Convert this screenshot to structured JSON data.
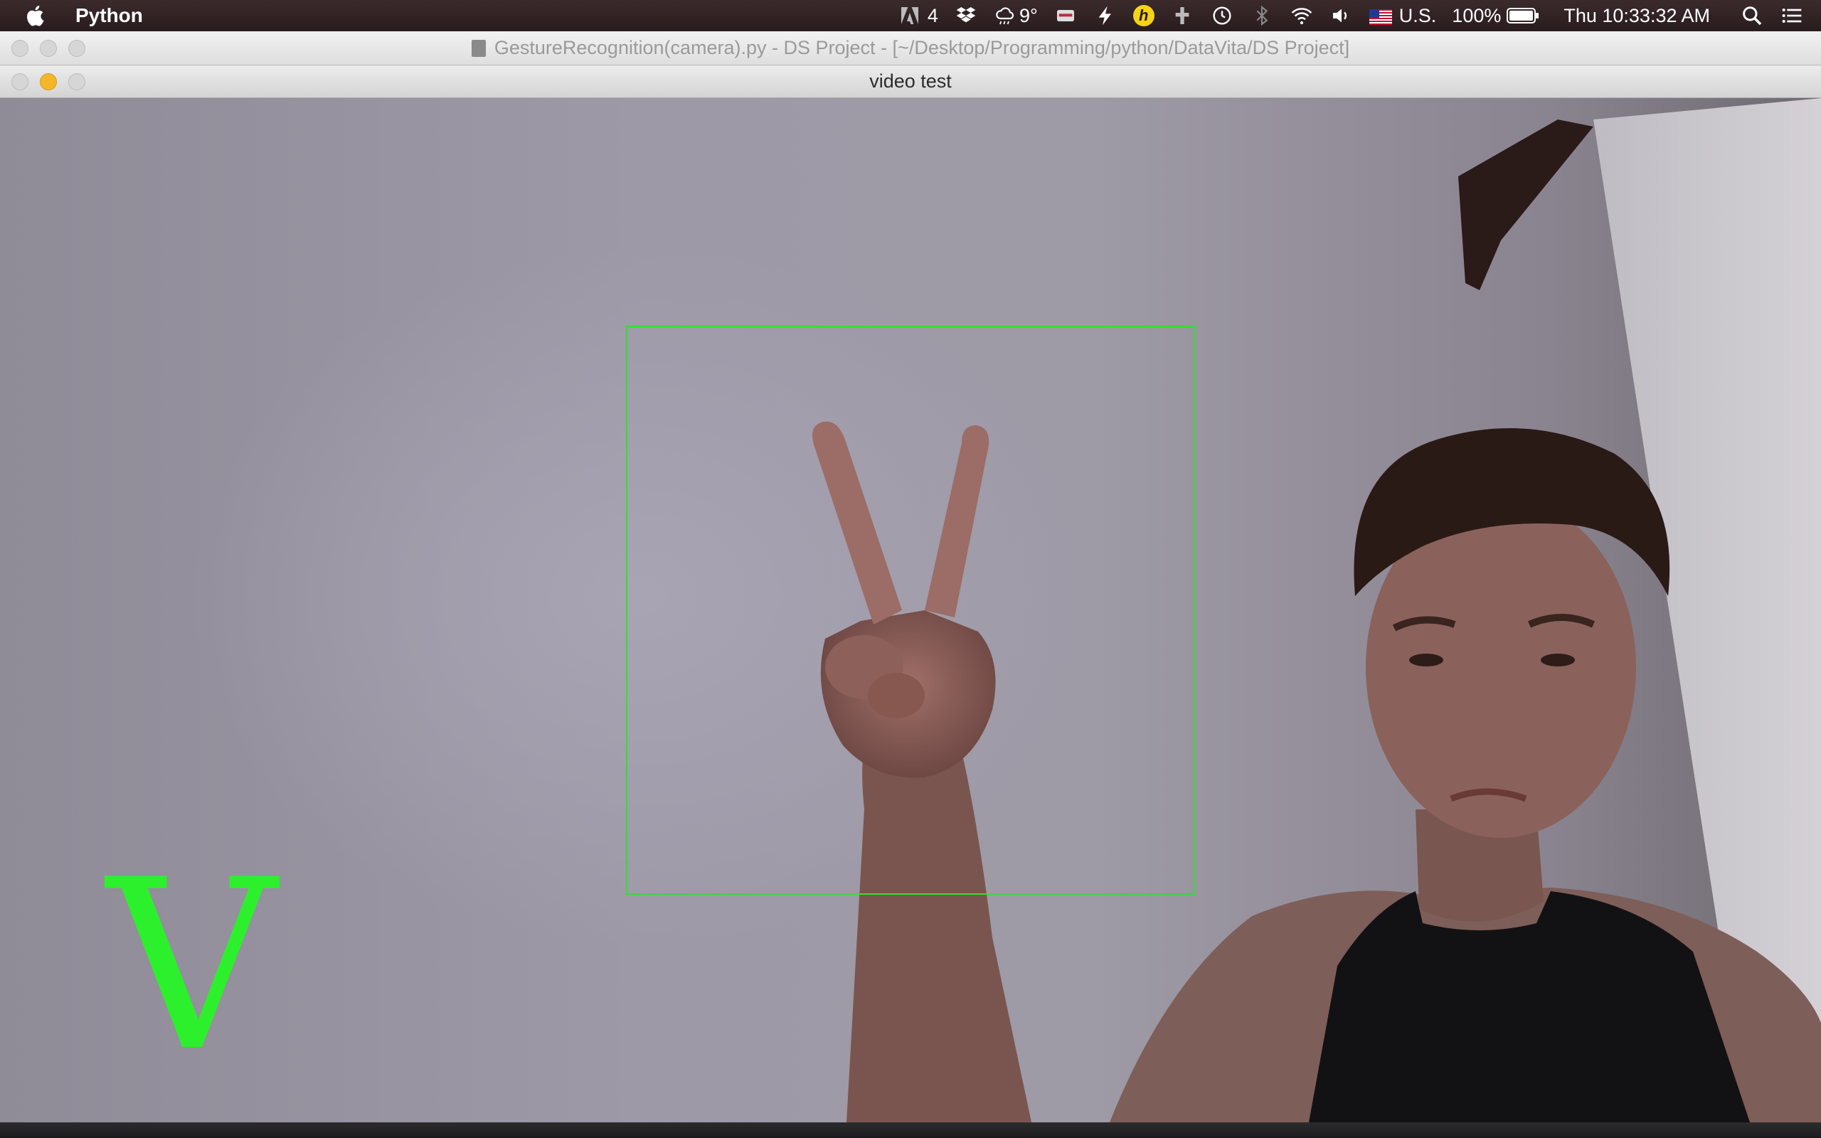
{
  "menubar": {
    "app_name": "Python",
    "adobe_count": "4",
    "weather_temp": "9°",
    "input_source": "U.S.",
    "battery_percent": "100%",
    "clock": "Thu 10:33:32 AM",
    "icons": [
      "apple-icon",
      "adobe-icon",
      "dropbox-icon",
      "weather-icon",
      "vpn-icon",
      "flash-icon",
      "h-badge-icon",
      "usb-icon",
      "time-machine-icon",
      "bluetooth-icon",
      "wifi-icon",
      "volume-icon",
      "us-flag-icon",
      "battery-icon",
      "spotlight-icon",
      "notification-center-icon"
    ]
  },
  "ide_window": {
    "title": "GestureRecognition(camera).py - DS Project - [~/Desktop/Programming/python/DataVita/DS Project]"
  },
  "video_window": {
    "title": "video test",
    "detected_gesture": "V",
    "roi_color": "#2fe02f",
    "label_color": "#2cf02c"
  }
}
